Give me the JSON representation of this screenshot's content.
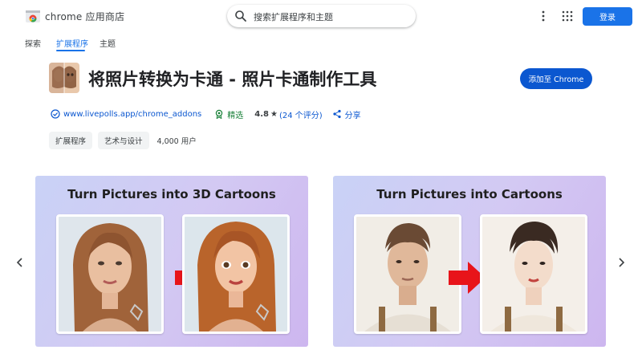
{
  "header": {
    "brand": "chrome 应用商店",
    "search_placeholder": "搜索扩展程序和主题",
    "login_label": "登录",
    "icons": [
      "chrome-webstore-logo",
      "search-icon",
      "more-vert-icon",
      "apps-grid-icon"
    ]
  },
  "nav": {
    "tabs": [
      {
        "label": "探索",
        "active": false
      },
      {
        "label": "扩展程序",
        "active": true
      },
      {
        "label": "主题",
        "active": false
      }
    ]
  },
  "extension": {
    "title": "将照片转换为卡通 - 照片卡通制作工具",
    "add_button_label": "添加至 Chrome",
    "website": "www.livepolls.app/chrome_addons",
    "featured_label": "精选",
    "rating": "4.8",
    "rating_count": "(24 个评分)",
    "share_label": "分享",
    "chips": [
      "扩展程序",
      "艺术与设计"
    ],
    "users": "4,000 用户"
  },
  "carousel": {
    "slides": [
      {
        "title": "Turn Pictures into 3D Cartoons"
      },
      {
        "title": "Turn Pictures into Cartoons"
      }
    ]
  },
  "colors": {
    "primary_blue": "#1a73e8",
    "add_button_blue": "#0b57d0",
    "featured_green": "#188038",
    "arrow_red": "#e8141a"
  }
}
